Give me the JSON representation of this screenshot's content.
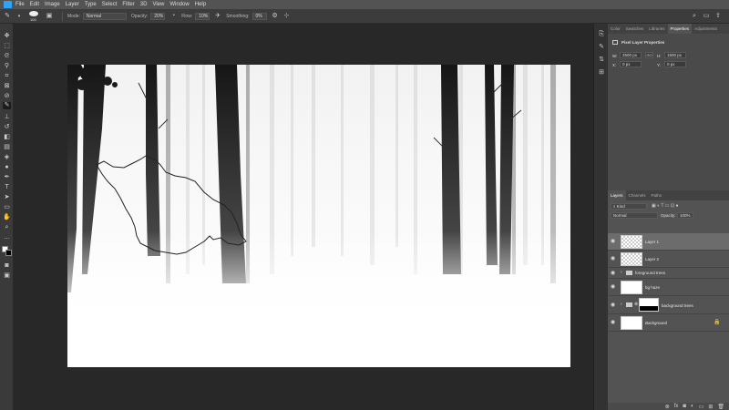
{
  "menu": {
    "items": [
      "File",
      "Edit",
      "Image",
      "Layer",
      "Type",
      "Select",
      "Filter",
      "3D",
      "View",
      "Window",
      "Help"
    ]
  },
  "options_bar": {
    "brush_size": "100",
    "mode_label": "Mode:",
    "mode_value": "Normal",
    "opacity_label": "Opacity:",
    "opacity_value": "20%",
    "flow_label": "Flow:",
    "flow_value": "10%",
    "smoothing_label": "Smoothing:",
    "smoothing_value": "0%"
  },
  "properties_panel": {
    "tabs": [
      "Color",
      "Swatches",
      "Libraries",
      "Properties",
      "Adjustments"
    ],
    "active_tab": "Properties",
    "title": "Pixel Layer Properties",
    "w_label": "W:",
    "w_value": "2500 px",
    "h_label": "H:",
    "h_value": "1500 px",
    "x_label": "X:",
    "x_value": "0 px",
    "y_label": "Y:",
    "y_value": "0 px",
    "link_icon": "GO"
  },
  "layers_panel": {
    "tabs": [
      "Layers",
      "Channels",
      "Paths"
    ],
    "active_tab": "Layers",
    "filter_label": "Kind",
    "blend_mode": "Normal",
    "opacity_label": "Opacity:",
    "opacity_value": "100%",
    "lock_label": "Lock:",
    "fill_label": "Fill:",
    "fill_value": "100%",
    "layers": [
      {
        "name": "Layer 1",
        "selected": true,
        "type": "pixel"
      },
      {
        "name": "Layer 2",
        "selected": false,
        "type": "pixel"
      },
      {
        "name": "foreground trees",
        "selected": false,
        "type": "group"
      },
      {
        "name": "bg haze",
        "selected": false,
        "type": "white"
      },
      {
        "name": "background trees",
        "selected": false,
        "type": "group-mask"
      },
      {
        "name": "Background",
        "selected": false,
        "type": "background"
      }
    ]
  },
  "colors": {
    "accent": "#2fa3f6",
    "panel_bg": "#535353",
    "workspace_bg": "#282828"
  }
}
